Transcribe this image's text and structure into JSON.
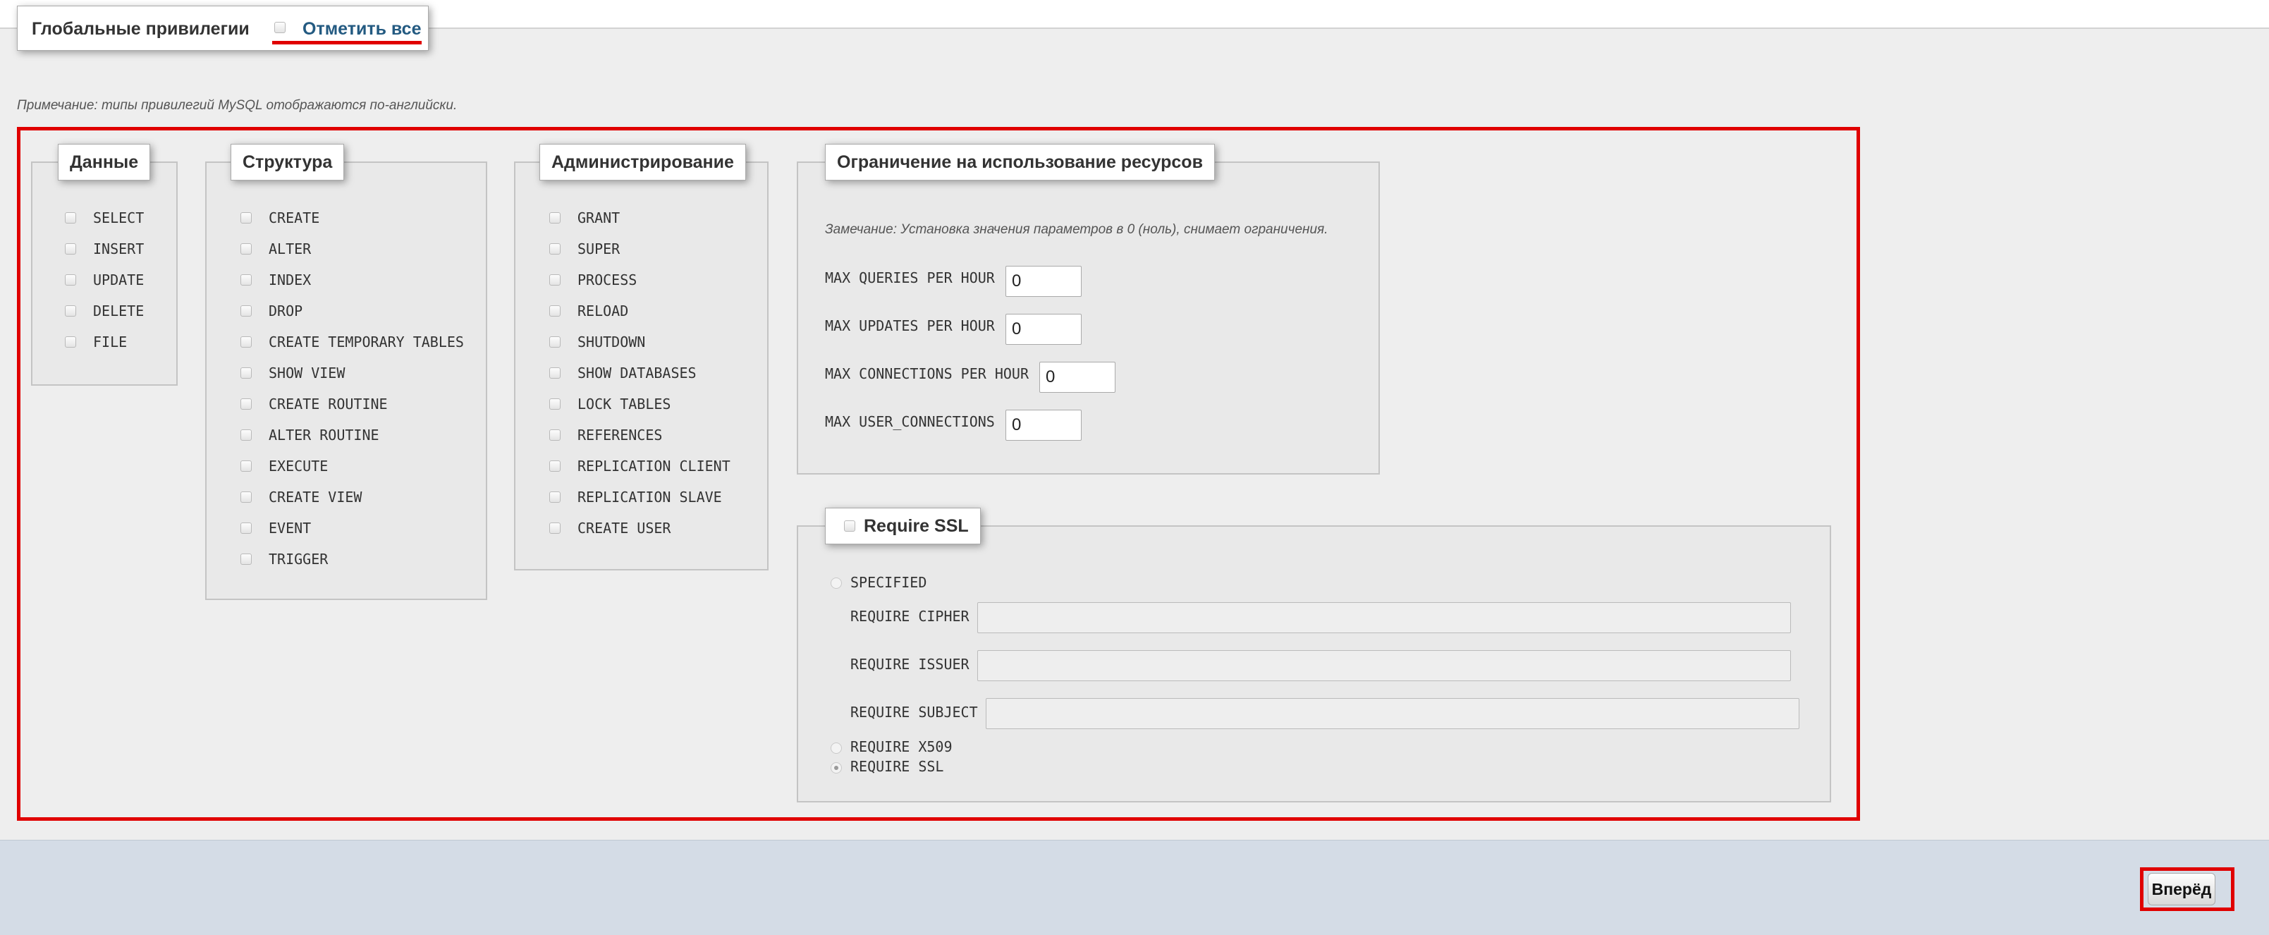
{
  "legend": {
    "title": "Глобальные привилегии",
    "check_all": "Отметить все"
  },
  "note": "Примечание: типы привилегий MySQL отображаются по-английски.",
  "data_group": {
    "title": "Данные",
    "items": [
      "SELECT",
      "INSERT",
      "UPDATE",
      "DELETE",
      "FILE"
    ]
  },
  "structure_group": {
    "title": "Структура",
    "items": [
      "CREATE",
      "ALTER",
      "INDEX",
      "DROP",
      "CREATE TEMPORARY TABLES",
      "SHOW VIEW",
      "CREATE ROUTINE",
      "ALTER ROUTINE",
      "EXECUTE",
      "CREATE VIEW",
      "EVENT",
      "TRIGGER"
    ]
  },
  "admin_group": {
    "title": "Администрирование",
    "items": [
      "GRANT",
      "SUPER",
      "PROCESS",
      "RELOAD",
      "SHUTDOWN",
      "SHOW DATABASES",
      "LOCK TABLES",
      "REFERENCES",
      "REPLICATION CLIENT",
      "REPLICATION SLAVE",
      "CREATE USER"
    ]
  },
  "resources": {
    "title": "Ограничение на использование ресурсов",
    "note": "Замечание: Установка значения параметров в 0 (ноль), снимает ограничения.",
    "fields": [
      {
        "label": "MAX QUERIES PER HOUR",
        "value": "0"
      },
      {
        "label": "MAX UPDATES PER HOUR",
        "value": "0"
      },
      {
        "label": "MAX CONNECTIONS PER HOUR",
        "value": "0"
      },
      {
        "label": "MAX USER_CONNECTIONS",
        "value": "0"
      }
    ]
  },
  "ssl": {
    "title": "Require SSL",
    "specified": "SPECIFIED",
    "cipher_label": "REQUIRE CIPHER",
    "issuer_label": "REQUIRE ISSUER",
    "subject_label": "REQUIRE SUBJECT",
    "x509": "REQUIRE X509",
    "ssl_opt": "REQUIRE SSL"
  },
  "footer": {
    "go_label": "Вперёд"
  }
}
